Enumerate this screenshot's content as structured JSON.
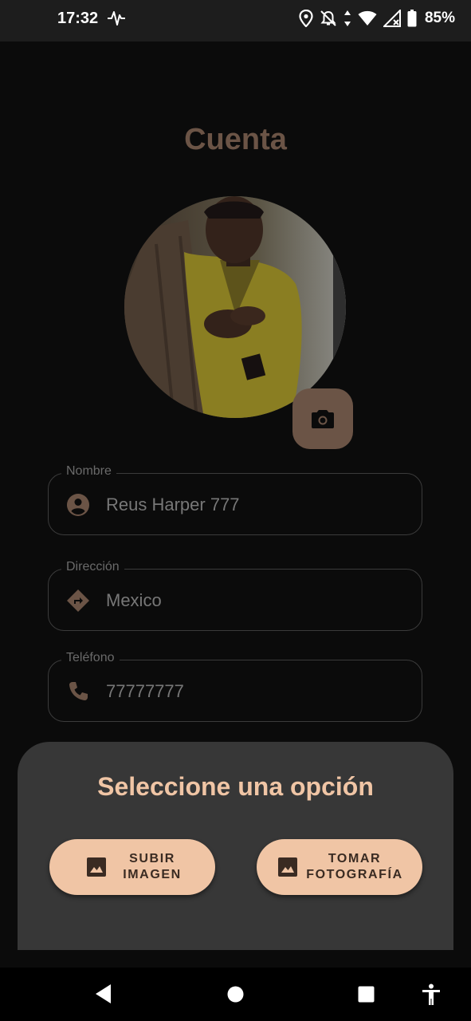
{
  "status_bar": {
    "time": "17:32",
    "battery": "85%",
    "icons": [
      "activity-pulse-icon",
      "location-icon",
      "notifications-off-icon",
      "data-arrows-icon",
      "wifi-icon",
      "cell-signal-icon",
      "battery-icon"
    ]
  },
  "page": {
    "title": "Cuenta",
    "avatar_alt": "profile-photo",
    "camera_icon": "camera-icon"
  },
  "fields": {
    "name": {
      "label": "Nombre",
      "value": "Reus Harper 777",
      "icon": "account-circle-icon"
    },
    "address": {
      "label": "Dirección",
      "value": "Mexico",
      "icon": "directions-icon"
    },
    "phone": {
      "label": "Teléfono",
      "value": "77777777",
      "icon": "phone-icon"
    }
  },
  "sheet": {
    "title": "Seleccione una opción",
    "upload_button": "SUBIR\nIMAGEN",
    "take_photo_button": "TOMAR\nFOTOGRAFÍA",
    "button_icon": "image-icon"
  },
  "nav_bar": {
    "items": [
      "back-icon",
      "home-icon",
      "recents-icon",
      "accessibility-icon"
    ]
  },
  "colors": {
    "accent": "#f0c5a5",
    "accent_dim": "#6b5446",
    "sheet_bg": "#373737",
    "background": "#0b0b0b"
  }
}
